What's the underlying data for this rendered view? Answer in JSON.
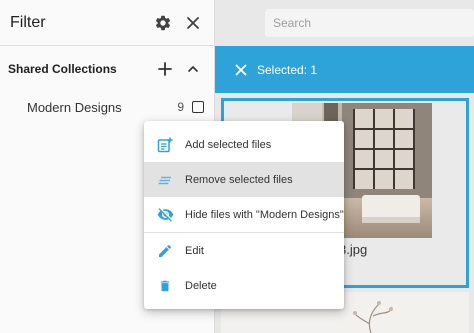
{
  "sidebar": {
    "title": "Filter",
    "section_title": "Shared Collections",
    "collections": [
      {
        "name": "Modern Designs",
        "count": "9"
      }
    ]
  },
  "search": {
    "placeholder": "Search"
  },
  "selection_bar": {
    "text": "Selected: 1"
  },
  "file": {
    "filename_visible": "3.jpg"
  },
  "context_menu": {
    "items": [
      {
        "label": "Add selected files",
        "icon": "add-to-collection-icon"
      },
      {
        "label": "Remove selected files",
        "icon": "remove-lines-icon"
      },
      {
        "label": "Hide files with \"Modern Designs\"",
        "icon": "eye-off-icon"
      },
      {
        "label": "Edit",
        "icon": "pencil-icon"
      },
      {
        "label": "Delete",
        "icon": "trash-icon"
      }
    ]
  },
  "colors": {
    "accent": "#2ea3d9",
    "menu_icon": "#2ea3d9",
    "sidebar_bg": "#fafafa",
    "main_bg": "#e8e8e8"
  }
}
